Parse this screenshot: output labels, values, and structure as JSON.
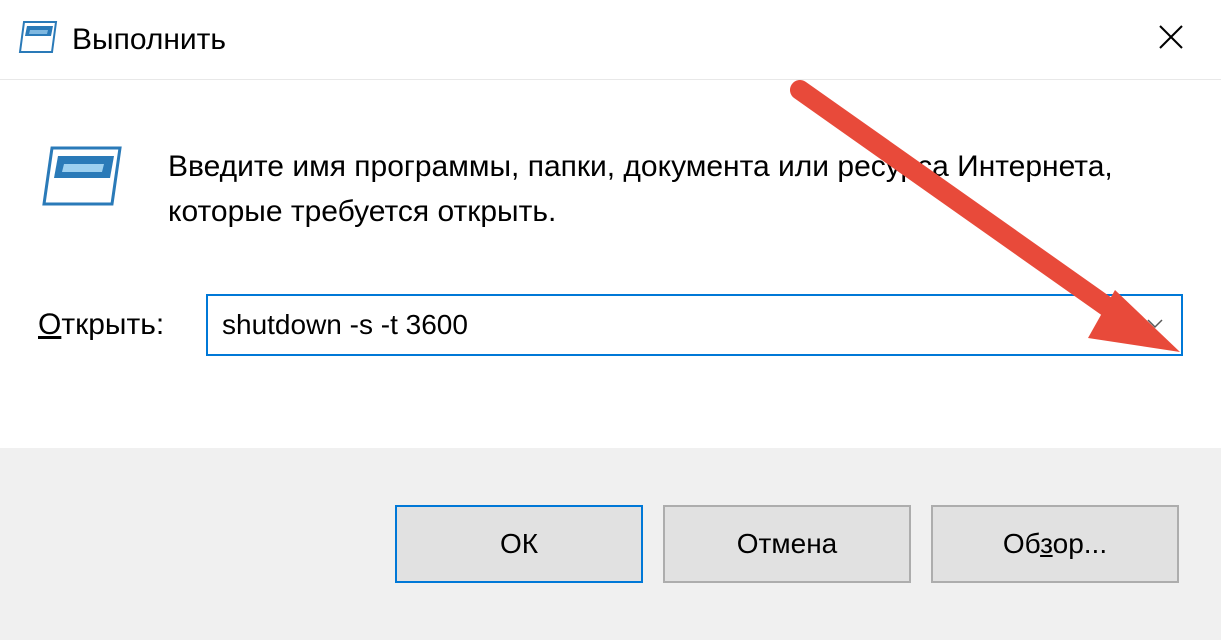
{
  "titlebar": {
    "title": "Выполнить"
  },
  "content": {
    "description": "Введите имя программы, папки, документа или ресурса Интернета, которые требуется открыть.",
    "open_label_prefix": "О",
    "open_label_rest": "ткрыть:",
    "input_value": "shutdown -s -t 3600"
  },
  "buttons": {
    "ok": "ОК",
    "cancel": "Отмена",
    "browse_prefix": "Об",
    "browse_underlined": "з",
    "browse_suffix": "ор..."
  }
}
